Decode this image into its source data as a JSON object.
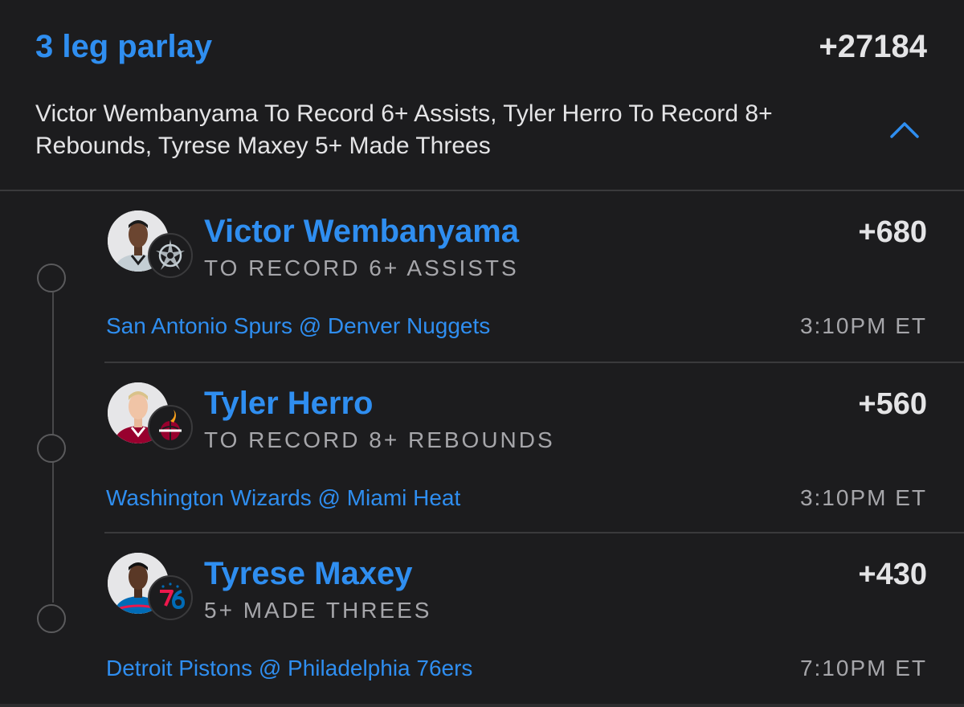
{
  "header": {
    "title": "3 leg parlay",
    "total_odds": "+27184",
    "summary": "Victor Wembanyama To Record 6+ Assists, Tyler Herro To Record 8+ Rebounds, Tyrese Maxey 5+ Made Threes",
    "toggle_icon": "chevron-up-icon"
  },
  "legs": [
    {
      "player": "Victor Wembanyama",
      "market": "TO RECORD 6+ ASSISTS",
      "odds": "+680",
      "matchup": "San Antonio Spurs @ Denver Nuggets",
      "time": "3:10PM ET",
      "team_icon": "spurs-logo-icon",
      "jersey_color": "#c4ced4"
    },
    {
      "player": "Tyler Herro",
      "market": "TO RECORD 8+ REBOUNDS",
      "odds": "+560",
      "matchup": "Washington Wizards @ Miami Heat",
      "time": "3:10PM ET",
      "team_icon": "heat-logo-icon",
      "jersey_color": "#98002e"
    },
    {
      "player": "Tyrese Maxey",
      "market": "5+ MADE THREES",
      "odds": "+430",
      "matchup": "Detroit Pistons @ Philadelphia 76ers",
      "time": "7:10PM ET",
      "team_icon": "sixers-logo-icon",
      "jersey_color": "#006bb6"
    }
  ],
  "colors": {
    "background": "#1c1c1e",
    "accent": "#2f8ef0",
    "primary_text": "#e4e4e6",
    "secondary_text": "#a6a6aa",
    "divider": "#3a3a3c"
  }
}
